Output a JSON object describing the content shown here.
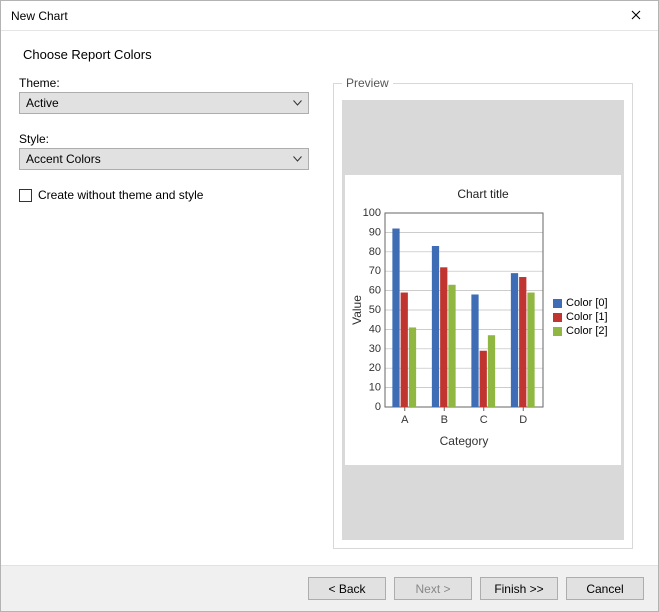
{
  "window": {
    "title": "New Chart"
  },
  "heading": "Choose Report Colors",
  "form": {
    "theme_label": "Theme:",
    "theme_value": "Active",
    "style_label": "Style:",
    "style_value": "Accent Colors",
    "checkbox_label": "Create without theme and style",
    "checkbox_checked": false
  },
  "preview": {
    "legend_title": "Preview"
  },
  "buttons": {
    "back": "< Back",
    "next": "Next >",
    "finish": "Finish >>",
    "cancel": "Cancel"
  },
  "chart_data": {
    "type": "bar",
    "title": "Chart title",
    "xlabel": "Category",
    "ylabel": "Value",
    "ylim": [
      0,
      100
    ],
    "yticks": [
      0,
      10,
      20,
      30,
      40,
      50,
      60,
      70,
      80,
      90,
      100
    ],
    "categories": [
      "A",
      "B",
      "C",
      "D"
    ],
    "series": [
      {
        "name": "Color [0]",
        "color": "#3E6DB5",
        "values": [
          92,
          83,
          58,
          69
        ]
      },
      {
        "name": "Color [1]",
        "color": "#C0352F",
        "values": [
          59,
          72,
          29,
          67
        ]
      },
      {
        "name": "Color [2]",
        "color": "#8FB742",
        "values": [
          41,
          63,
          37,
          59
        ]
      }
    ]
  }
}
